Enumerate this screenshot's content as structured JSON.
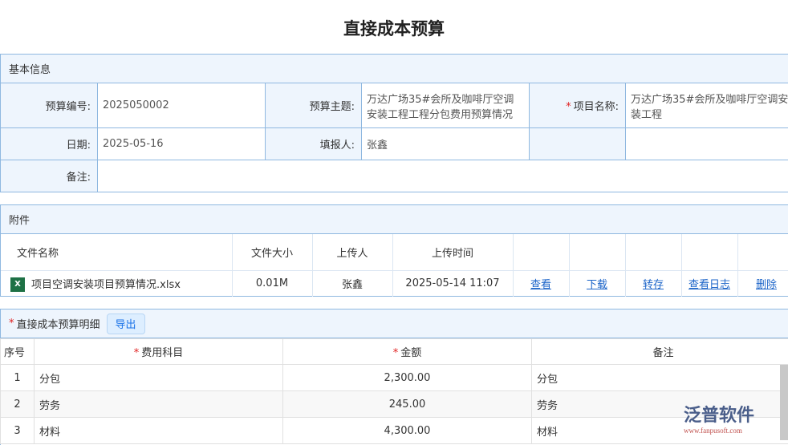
{
  "title": "直接成本预算",
  "basic": {
    "header": "基本信息",
    "budget_no_label": "预算编号:",
    "budget_no": "2025050002",
    "subject_label": "预算主题:",
    "subject": "万达广场35#会所及咖啡厅空调安装工程工程分包费用预算情况",
    "project_label": "项目名称:",
    "project": "万达广场35#会所及咖啡厅空调安装工程",
    "date_label": "日期:",
    "date": "2025-05-16",
    "reporter_label": "填报人:",
    "reporter": "张鑫",
    "remark_label": "备注:"
  },
  "attach": {
    "header": "附件",
    "columns": [
      "文件名称",
      "文件大小",
      "上传人",
      "上传时间"
    ],
    "file": {
      "name": "项目空调安装项目预算情况.xlsx",
      "size": "0.01M",
      "uploader": "张鑫",
      "time": "2025-05-14 11:07"
    },
    "actions": [
      "查看",
      "下载",
      "转存",
      "查看日志",
      "删除"
    ]
  },
  "detail": {
    "header": "直接成本预算明细",
    "export": "导出",
    "columns": [
      "序号",
      "费用科目",
      "金额",
      "备注"
    ],
    "rows": [
      [
        "1",
        "分包",
        "2,300.00",
        "分包"
      ],
      [
        "2",
        "劳务",
        "245.00",
        "劳务"
      ],
      [
        "3",
        "材料",
        "4,300.00",
        "材料"
      ]
    ]
  },
  "watermark": {
    "name": "泛普软件",
    "url": "www.fanpusoft.com"
  }
}
